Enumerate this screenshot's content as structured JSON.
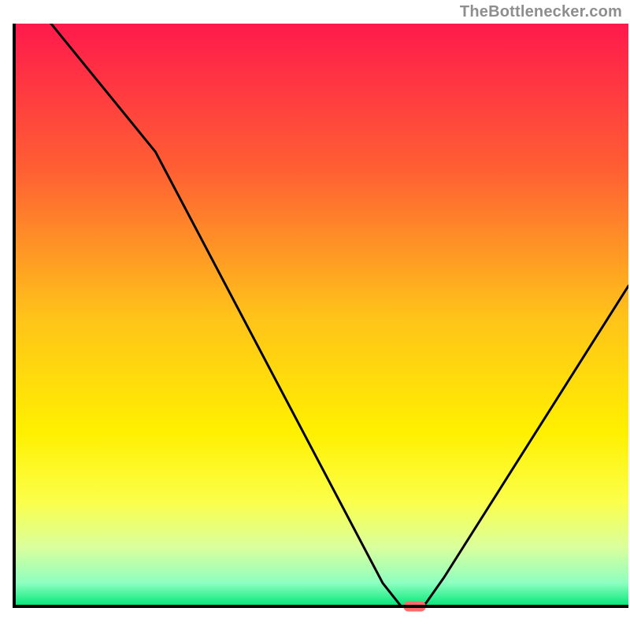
{
  "attribution": "TheBottlenecker.com",
  "chart_data": {
    "type": "line",
    "title": "",
    "xlabel": "",
    "ylabel": "",
    "xlim": [
      0,
      100
    ],
    "ylim": [
      0,
      100
    ],
    "x": [
      0,
      6,
      23,
      60,
      63,
      64.5,
      67,
      70,
      100
    ],
    "values": [
      108,
      100,
      78,
      4,
      0,
      0,
      0.5,
      5,
      55
    ],
    "background_gradient_stops": [
      {
        "offset": 0,
        "color": "#ff1a4c"
      },
      {
        "offset": 25,
        "color": "#ff5f33"
      },
      {
        "offset": 50,
        "color": "#ffc21a"
      },
      {
        "offset": 70,
        "color": "#fff000"
      },
      {
        "offset": 82,
        "color": "#fbff4a"
      },
      {
        "offset": 90,
        "color": "#d9ff9e"
      },
      {
        "offset": 96,
        "color": "#8dffc0"
      },
      {
        "offset": 100,
        "color": "#00e676"
      }
    ],
    "marker": {
      "x": 65.2,
      "y": 0,
      "color": "#ff6b6b"
    },
    "axis_color": "#000000",
    "curve_color": "#000000"
  }
}
